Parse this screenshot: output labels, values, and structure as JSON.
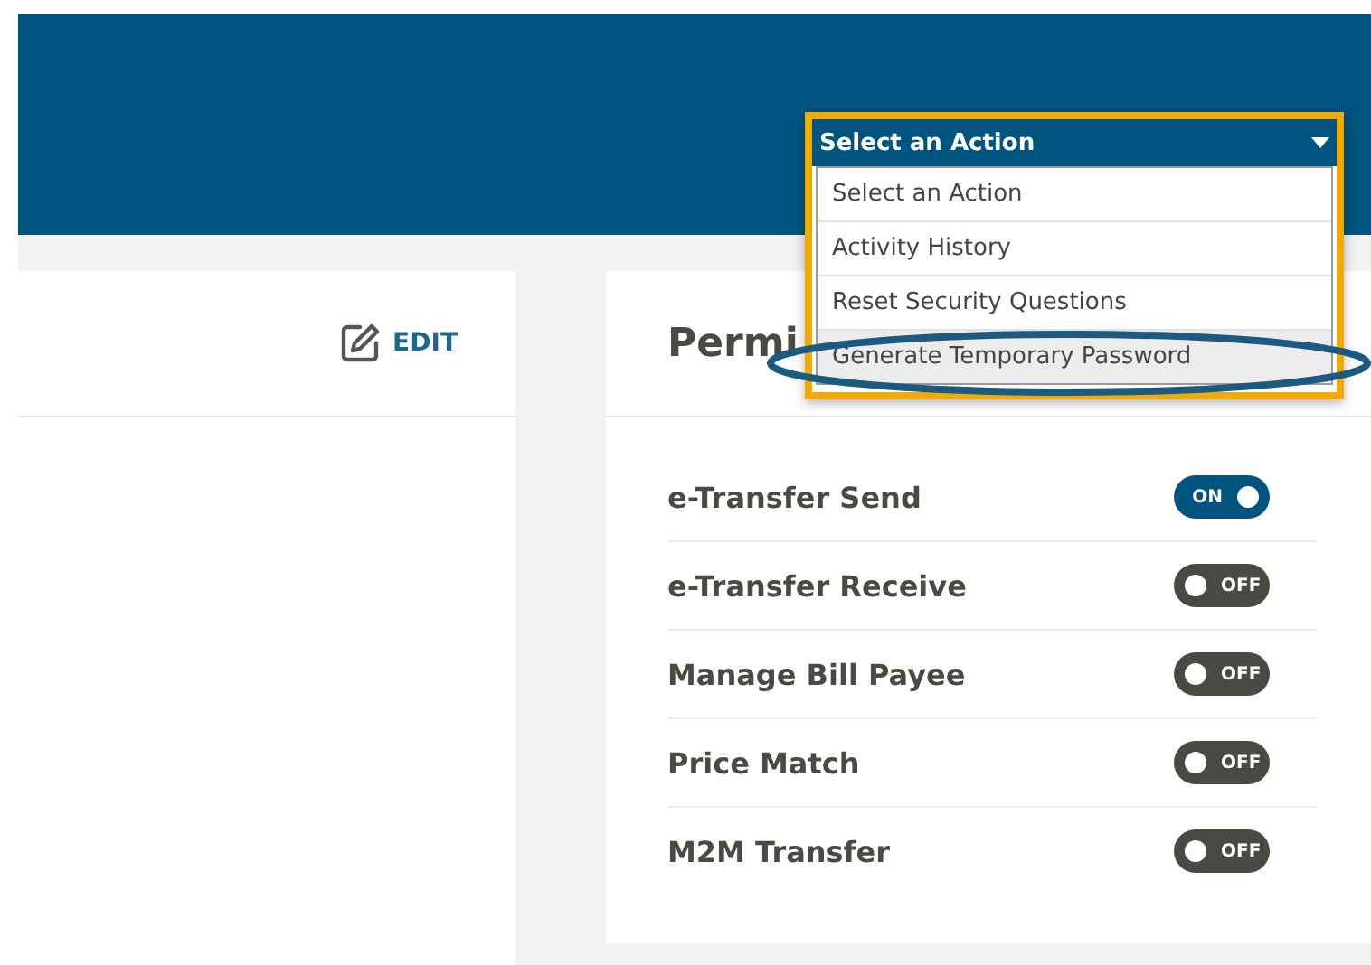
{
  "header": {
    "action_select": {
      "value": "Select an Action",
      "expanded": true,
      "options": [
        {
          "label": "Select an Action",
          "highlighted": false
        },
        {
          "label": "Activity History",
          "highlighted": false
        },
        {
          "label": "Reset Security Questions",
          "highlighted": false
        },
        {
          "label": "Generate Temporary Password",
          "highlighted": true
        }
      ]
    }
  },
  "profile_card": {
    "edit_label": "EDIT"
  },
  "permissions_card": {
    "title": "Permi",
    "permissions": [
      {
        "label": "e-Transfer Send",
        "on": true,
        "state_text": "ON"
      },
      {
        "label": "e-Transfer Receive",
        "on": false,
        "state_text": "OFF"
      },
      {
        "label": "Manage Bill Payee",
        "on": false,
        "state_text": "OFF"
      },
      {
        "label": "Price Match",
        "on": false,
        "state_text": "OFF"
      },
      {
        "label": "M2M Transfer",
        "on": false,
        "state_text": "OFF"
      }
    ]
  }
}
